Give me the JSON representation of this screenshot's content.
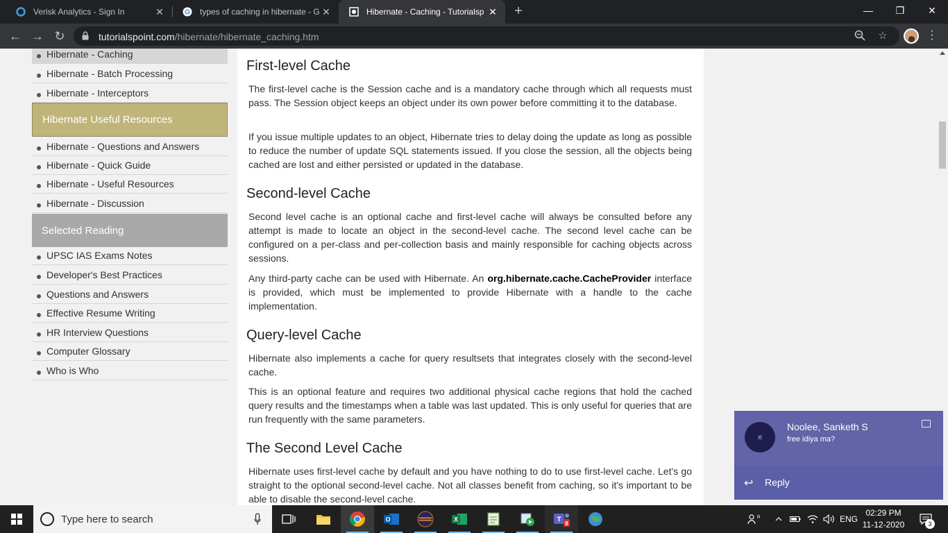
{
  "browser": {
    "tabs": [
      {
        "title": "Verisk Analytics - Sign In",
        "icon": "verisk-circle-icon",
        "active": false
      },
      {
        "title": "types of caching in hibernate - G",
        "icon": "google-g-icon",
        "active": false
      },
      {
        "title": "Hibernate - Caching - Tutorialsp",
        "icon": "tutorialspoint-icon",
        "active": true
      }
    ],
    "new_tab": "+",
    "url_host": "tutorialspoint.com",
    "url_path": "/hibernate/hibernate_caching.htm",
    "window_controls": {
      "minimize": "—",
      "restore": "❐",
      "close": "✕"
    }
  },
  "sidebar": {
    "top_items": [
      {
        "label": "Hibernate - Caching",
        "current": true
      },
      {
        "label": "Hibernate - Batch Processing",
        "current": false
      },
      {
        "label": "Hibernate - Interceptors",
        "current": false
      }
    ],
    "resources_header": "Hibernate Useful Resources",
    "resources_items": [
      "Hibernate - Questions and Answers",
      "Hibernate - Quick Guide",
      "Hibernate - Useful Resources",
      "Hibernate - Discussion"
    ],
    "reading_header": "Selected Reading",
    "reading_items": [
      "UPSC IAS Exams Notes",
      "Developer's Best Practices",
      "Questions and Answers",
      "Effective Resume Writing",
      "HR Interview Questions",
      "Computer Glossary",
      "Who is Who"
    ]
  },
  "article": {
    "h_first": "First-level Cache",
    "p_first_1": "The first-level cache is the Session cache and is a mandatory cache through which all requests must pass. The Session object keeps an object under its own power before committing it to the database.",
    "p_first_2": "If you issue multiple updates to an object, Hibernate tries to delay doing the update as long as possible to reduce the number of update SQL statements issued. If you close the session, all the objects being cached are lost and either persisted or updated in the database.",
    "h_second": "Second-level Cache",
    "p_second_1": "Second level cache is an optional cache and first-level cache will always be consulted before any attempt is made to locate an object in the second-level cache. The second level cache can be configured on a per-class and per-collection basis and mainly responsible for caching objects across sessions.",
    "p_second_2_pre": "Any third-party cache can be used with Hibernate. An ",
    "p_second_2_bold": "org.hibernate.cache.CacheProvider",
    "p_second_2_post": " interface is provided, which must be implemented to provide Hibernate with a handle to the cache implementation.",
    "h_query": "Query-level Cache",
    "p_query_1": "Hibernate also implements a cache for query resultsets that integrates closely with the second-level cache.",
    "p_query_2": "This is an optional feature and requires two additional physical cache regions that hold the cached query results and the timestamps when a table was last updated. This is only useful for queries that are run frequently with the same parameters.",
    "h_slc": "The Second Level Cache",
    "p_slc_1": "Hibernate uses first-level cache by default and you have nothing to do to use first-level cache. Let's go straight to the optional second-level cache. Not all classes benefit from caching, so it's important to be able to disable the second-level cache."
  },
  "toast": {
    "sender": "Noolee, Sanketh S",
    "message": "free idiya ma?",
    "avatar_text": "ಶ",
    "reply_label": "Reply"
  },
  "taskbar": {
    "search_placeholder": "Type here to search",
    "apps": [
      "task-view-icon",
      "file-explorer-icon",
      "chrome-icon",
      "outlook-icon",
      "eclipse-icon",
      "excel-icon",
      "notepad-icon",
      "media-icon",
      "teams-icon",
      "network-globe-icon"
    ],
    "teams_badge": "8",
    "language": "ENG",
    "time": "02:29 PM",
    "date": "11-12-2020",
    "notification_count": "3"
  }
}
